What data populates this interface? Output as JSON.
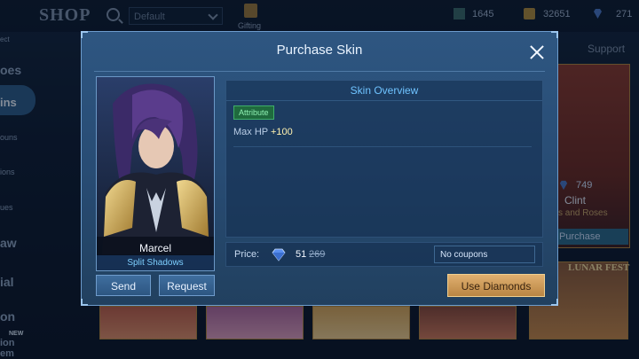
{
  "background": {
    "shop_title": "SHOP",
    "search_value": "Default",
    "gifting_label": "Gifting",
    "currencies": [
      {
        "icon": "ticket-icon",
        "value": "1645"
      },
      {
        "icon": "battle-points-icon",
        "value": "32651"
      },
      {
        "icon": "diamond-icon",
        "value": "271"
      }
    ],
    "support_label": "Support",
    "side_items": [
      "ect",
      "oes",
      "ins",
      "ouns",
      "ions",
      "ues",
      "aw",
      "ial",
      "on",
      "NEW",
      "ion",
      "em"
    ],
    "card": {
      "price": "749",
      "hero": "Clint",
      "skin": "s and Roses",
      "button": "Purchase"
    },
    "card2_text": "LUNAR FEST"
  },
  "modal": {
    "title": "Purchase Skin",
    "hero_name": "Marcel",
    "skin_name": "Split Shadows",
    "send_label": "Send",
    "request_label": "Request",
    "overview_title": "Skin Overview",
    "attribute_badge": "Attribute",
    "attribute_name": "Max HP",
    "attribute_value": "+100",
    "price_label": "Price:",
    "price_now": "51",
    "price_old": "269",
    "coupon_text": "No coupons",
    "use_button": "Use Diamonds"
  },
  "colors": {
    "accent_blue": "#6fc3ff",
    "gold_button": "#d6a55f",
    "attribute_green": "#1f6a3e"
  }
}
